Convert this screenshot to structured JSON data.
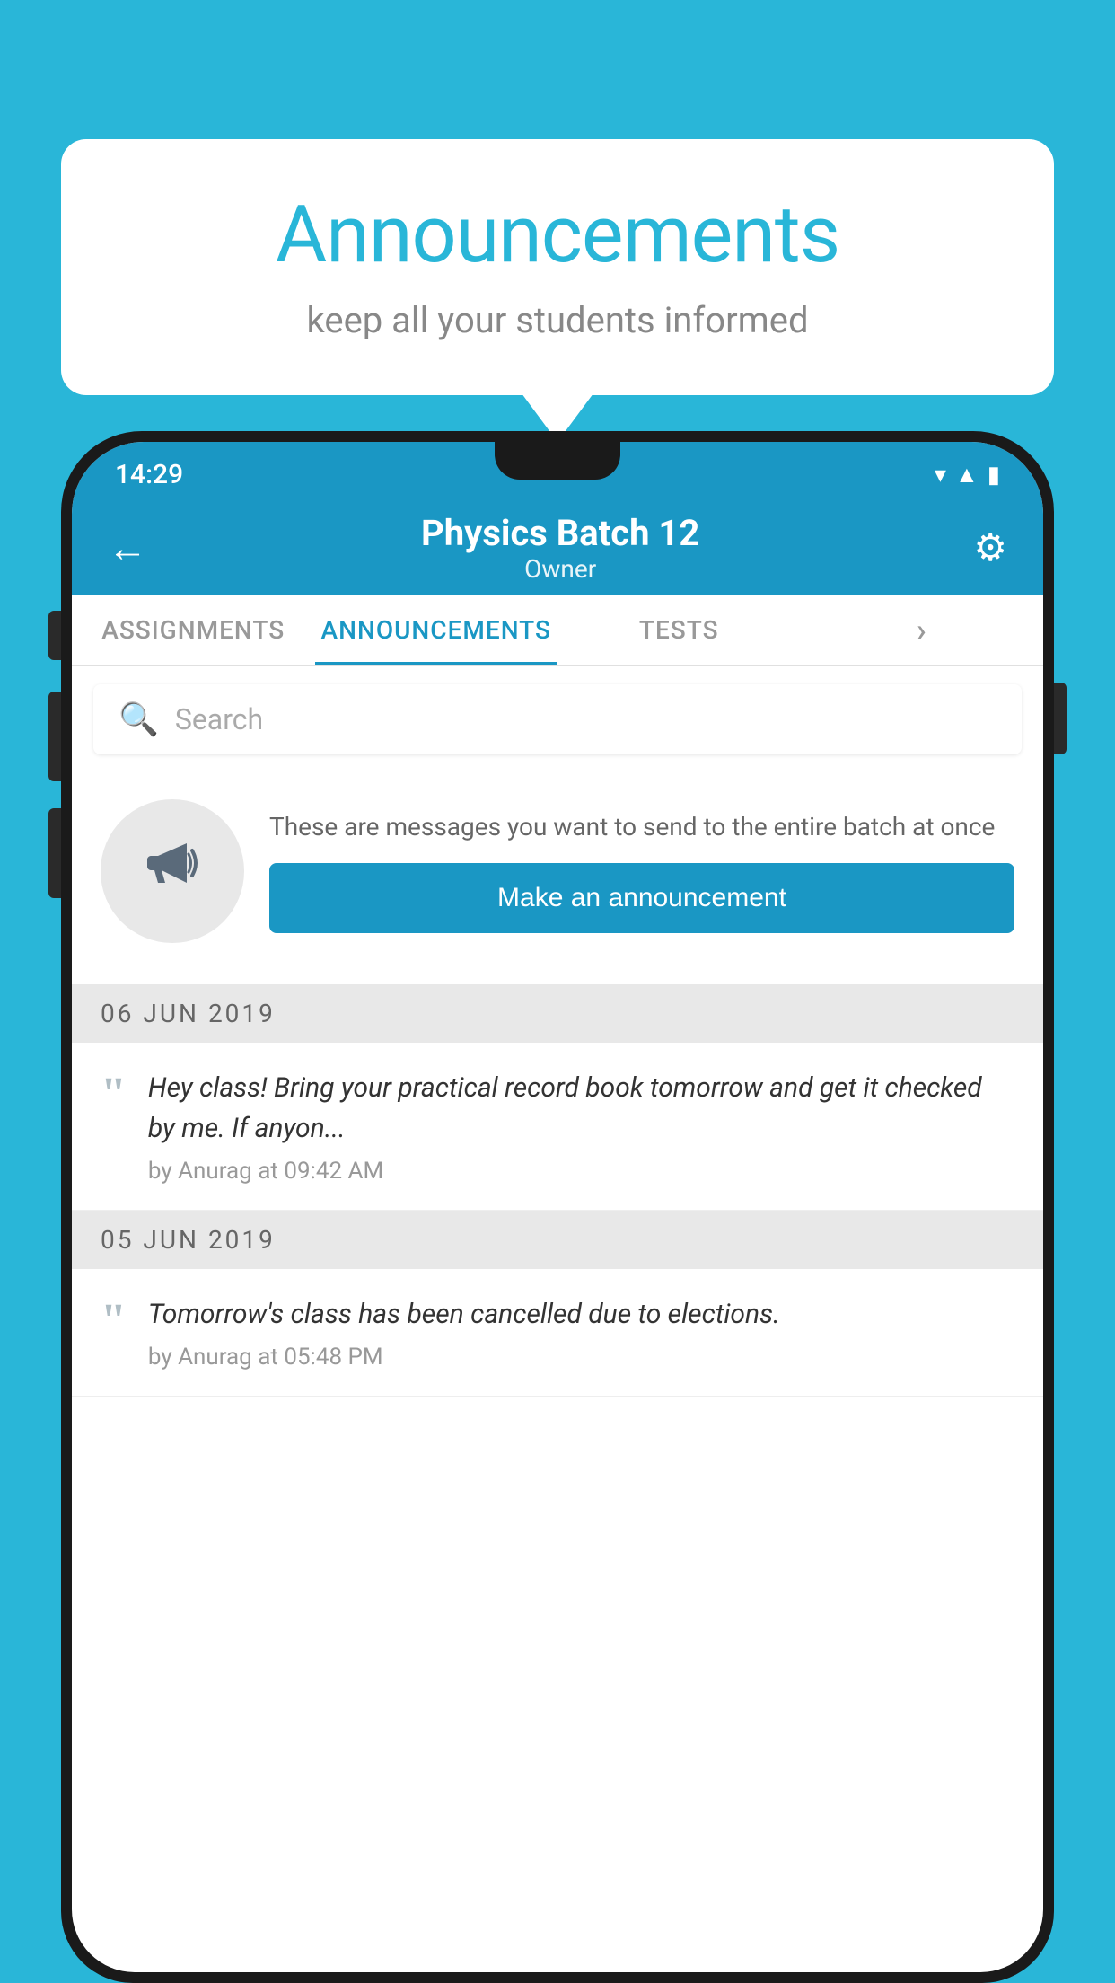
{
  "background_color": "#29b6d8",
  "speech_bubble": {
    "title": "Announcements",
    "subtitle": "keep all your students informed"
  },
  "status_bar": {
    "time": "14:29",
    "icons": [
      "wifi",
      "signal",
      "battery"
    ]
  },
  "app_bar": {
    "back_icon": "←",
    "title": "Physics Batch 12",
    "subtitle": "Owner",
    "settings_icon": "⚙"
  },
  "tabs": [
    {
      "label": "ASSIGNMENTS",
      "active": false
    },
    {
      "label": "ANNOUNCEMENTS",
      "active": true
    },
    {
      "label": "TESTS",
      "active": false
    },
    {
      "label": "MORE",
      "active": false
    }
  ],
  "search": {
    "placeholder": "Search"
  },
  "promo": {
    "description": "These are messages you want to send to the entire batch at once",
    "button_label": "Make an announcement"
  },
  "announcements": [
    {
      "date": "06  JUN  2019",
      "text": "Hey class! Bring your practical record book tomorrow and get it checked by me. If anyon...",
      "meta": "by Anurag at 09:42 AM"
    },
    {
      "date": "05  JUN  2019",
      "text": "Tomorrow's class has been cancelled due to elections.",
      "meta": "by Anurag at 05:48 PM"
    }
  ]
}
